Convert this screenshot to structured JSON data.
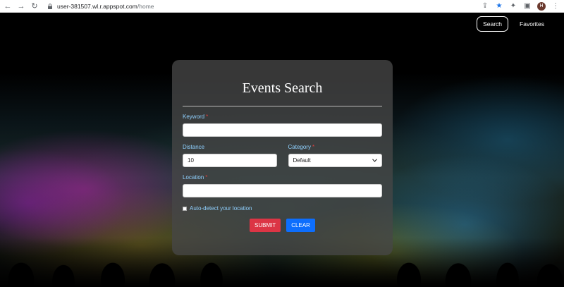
{
  "browser": {
    "url_host": "user-381507.wl.r.appspot.com",
    "url_path": "/home",
    "avatar_letter": "H"
  },
  "nav": {
    "search_label": "Search",
    "favorites_label": "Favorites"
  },
  "form": {
    "title": "Events Search",
    "keyword_label": "Keyword",
    "keyword_value": "",
    "distance_label": "Distance",
    "distance_value": "10",
    "category_label": "Category",
    "category_value": "Default",
    "location_label": "Location",
    "location_value": "",
    "required_marker": "*",
    "autodetect_label": "Auto-detect your location",
    "autodetect_checked": false,
    "submit_label": "SUBMIT",
    "clear_label": "CLEAR"
  },
  "colors": {
    "label": "#8fd0ff",
    "submit": "#dc3545",
    "clear": "#0d6efd",
    "required": "#e04040"
  }
}
